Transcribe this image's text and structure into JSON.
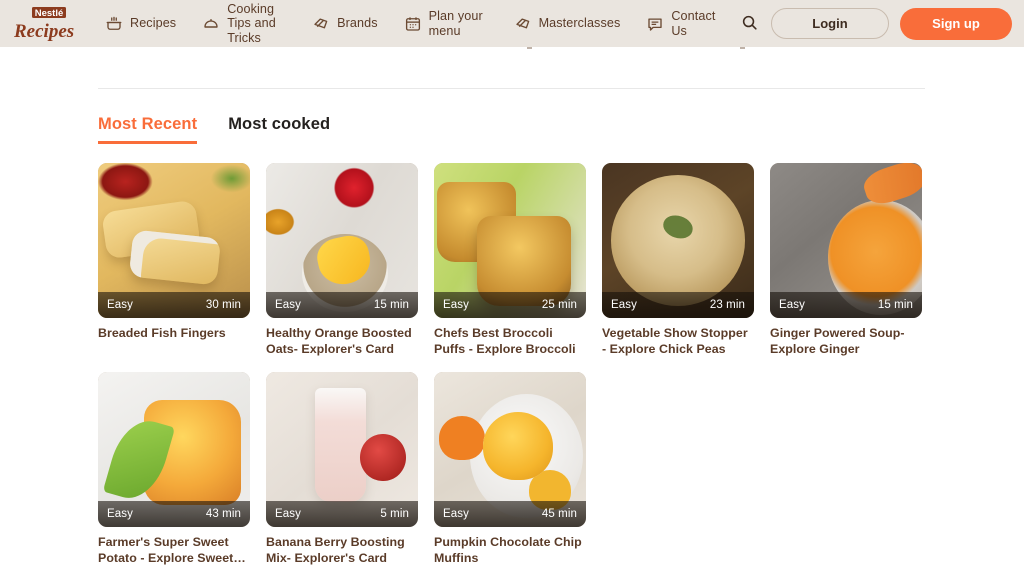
{
  "header": {
    "logo_alt": "Nestle Recipes",
    "logo_line1": "Nestlé",
    "logo_line2": "Recipes",
    "nav": [
      {
        "label": "Recipes",
        "icon": "pot-icon"
      },
      {
        "label": "Cooking Tips and Tricks",
        "icon": "pot-lid-icon"
      },
      {
        "label": "Brands",
        "icon": "brands-tag-icon"
      },
      {
        "label": "Plan your menu",
        "icon": "calendar-icon"
      },
      {
        "label": "Masterclasses",
        "icon": "masterclass-tag-icon"
      },
      {
        "label": "Contact Us",
        "icon": "chat-bubble-icon"
      }
    ],
    "search_icon": "search-icon",
    "login_label": "Login",
    "signup_label": "Sign up",
    "accent_color": "#F96D3A",
    "background_color": "#EAE5DF",
    "text_color": "#5A3B28"
  },
  "tabs": [
    {
      "label": "Most Recent",
      "active": true
    },
    {
      "label": "Most cooked",
      "active": false
    }
  ],
  "recipes": [
    {
      "title": "Breaded Fish Fingers",
      "difficulty": "Easy",
      "time": "30 min",
      "art": "art-fish",
      "image_alt": "Breaded fish fingers with ketchup"
    },
    {
      "title": "Healthy Orange Boosted Oats- Explorer's Card",
      "difficulty": "Easy",
      "time": "15 min",
      "art": "art-oats",
      "image_alt": "Bowl of oats with orange slices, apple and honey"
    },
    {
      "title": "Chefs Best Broccoli Puffs - Explore Broccoli",
      "difficulty": "Easy",
      "time": "25 min",
      "art": "art-broccoli",
      "image_alt": "Broccoli puffs on a plate with greens"
    },
    {
      "title": "Vegetable Show Stopper - Explore Chick Peas",
      "difficulty": "Easy",
      "time": "23 min",
      "art": "art-chick",
      "image_alt": "Chickpea hummus dip garnished with herbs"
    },
    {
      "title": "Ginger Powered Soup- Explore Ginger",
      "difficulty": "Easy",
      "time": "15 min",
      "art": "art-ginger",
      "image_alt": "Bowl of carrot ginger soup"
    },
    {
      "title": "Farmer's Super Sweet Potato - Explore Sweet…",
      "difficulty": "Easy",
      "time": "43 min",
      "art": "art-potato",
      "image_alt": "Sweet potato mash with basil garnish"
    },
    {
      "title": "Banana Berry Boosting Mix- Explorer's Card",
      "difficulty": "Easy",
      "time": "5 min",
      "art": "art-banana",
      "image_alt": "Banana berry smoothie in a glass"
    },
    {
      "title": "Pumpkin Chocolate Chip Muffins",
      "difficulty": "Easy",
      "time": "45 min",
      "art": "art-pumpkin",
      "image_alt": "Pumpkin chocolate chip muffins on a plate"
    }
  ]
}
